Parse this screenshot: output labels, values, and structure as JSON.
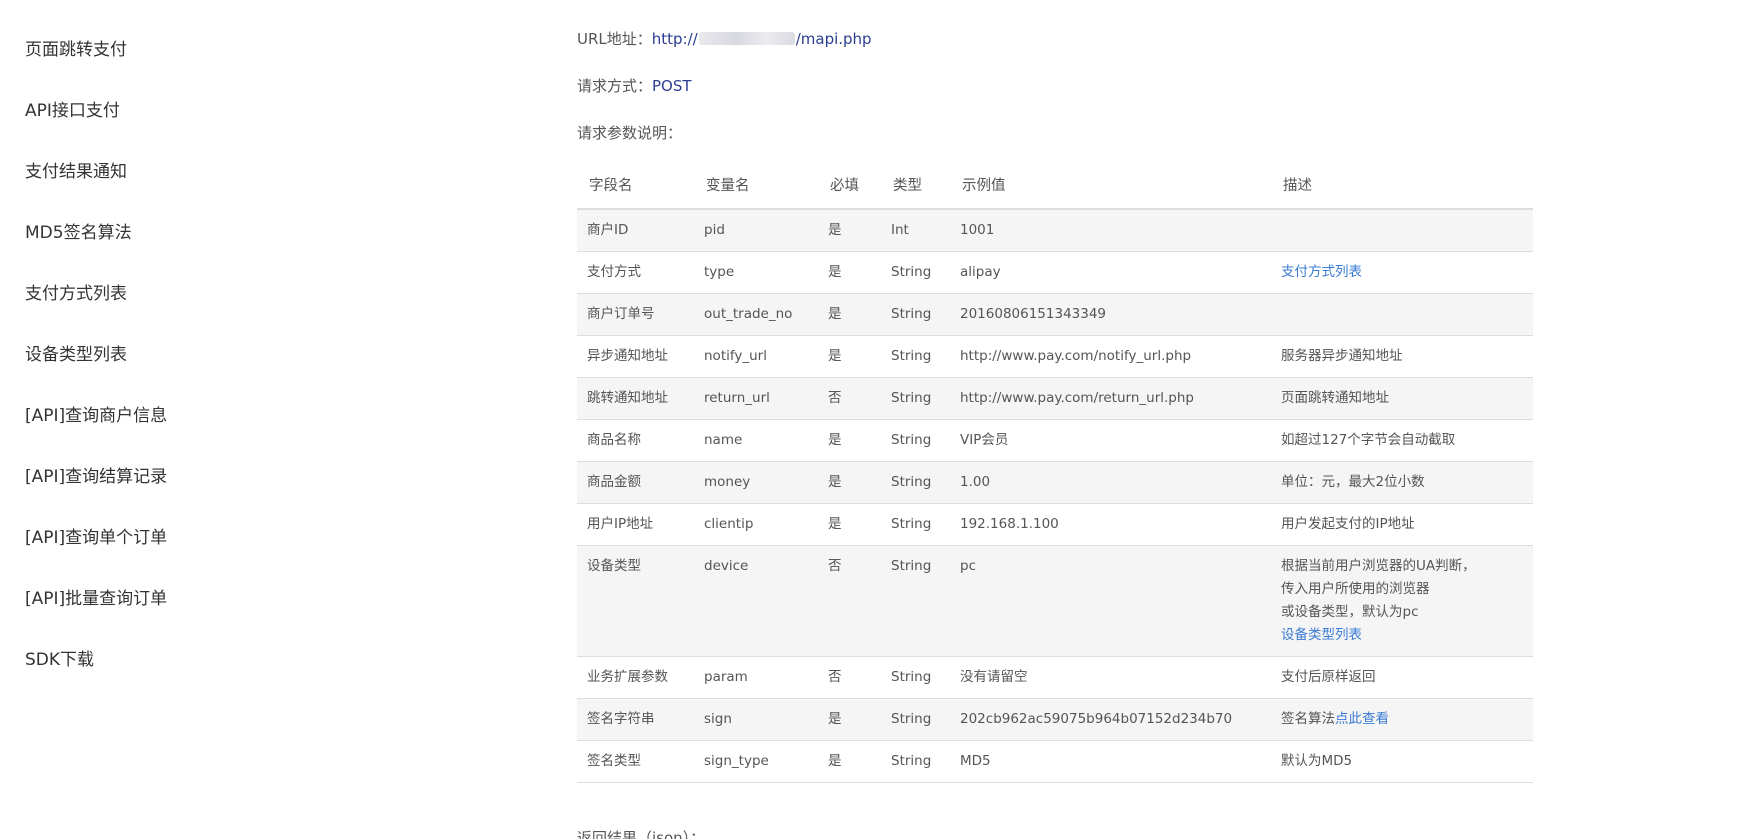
{
  "sidebar": {
    "items": [
      {
        "label": "页面跳转支付"
      },
      {
        "label": "API接口支付"
      },
      {
        "label": "支付结果通知"
      },
      {
        "label": "MD5签名算法"
      },
      {
        "label": "支付方式列表"
      },
      {
        "label": "设备类型列表"
      },
      {
        "label": "[API]查询商户信息"
      },
      {
        "label": "[API]查询结算记录"
      },
      {
        "label": "[API]查询单个订单"
      },
      {
        "label": "[API]批量查询订单"
      },
      {
        "label": "SDK下载"
      }
    ]
  },
  "main": {
    "url_label": "URL地址：",
    "url_prefix": "http://",
    "url_suffix": "/mapi.php",
    "method_label": "请求方式：",
    "method_value": "POST",
    "params_label": "请求参数说明：",
    "return_label": "返回结果（json）：",
    "table": {
      "headers": [
        "字段名",
        "变量名",
        "必填",
        "类型",
        "示例值",
        "描述"
      ],
      "rows": [
        {
          "field": "商户ID",
          "var": "pid",
          "required": "是",
          "type": "Int",
          "example": "1001",
          "desc": ""
        },
        {
          "field": "支付方式",
          "var": "type",
          "required": "是",
          "type": "String",
          "example": "alipay",
          "desc_link": "支付方式列表"
        },
        {
          "field": "商户订单号",
          "var": "out_trade_no",
          "required": "是",
          "type": "String",
          "example": "20160806151343349",
          "desc": ""
        },
        {
          "field": "异步通知地址",
          "var": "notify_url",
          "required": "是",
          "type": "String",
          "example": "http://www.pay.com/notify_url.php",
          "desc": "服务器异步通知地址"
        },
        {
          "field": "跳转通知地址",
          "var": "return_url",
          "required": "否",
          "type": "String",
          "example": "http://www.pay.com/return_url.php",
          "desc": "页面跳转通知地址"
        },
        {
          "field": "商品名称",
          "var": "name",
          "required": "是",
          "type": "String",
          "example": "VIP会员",
          "desc": "如超过127个字节会自动截取"
        },
        {
          "field": "商品金额",
          "var": "money",
          "required": "是",
          "type": "String",
          "example": "1.00",
          "desc": "单位：元，最大2位小数"
        },
        {
          "field": "用户IP地址",
          "var": "clientip",
          "required": "是",
          "type": "String",
          "example": "192.168.1.100",
          "desc": "用户发起支付的IP地址"
        },
        {
          "field": "设备类型",
          "var": "device",
          "required": "否",
          "type": "String",
          "example": "pc",
          "desc_line1": "根据当前用户浏览器的UA判断，",
          "desc_line2": "传入用户所使用的浏览器",
          "desc_line3": "或设备类型，默认为pc",
          "desc_link": "设备类型列表"
        },
        {
          "field": "业务扩展参数",
          "var": "param",
          "required": "否",
          "type": "String",
          "example": "没有请留空",
          "desc": "支付后原样返回"
        },
        {
          "field": "签名字符串",
          "var": "sign",
          "required": "是",
          "type": "String",
          "example": "202cb962ac59075b964b07152d234b70",
          "desc": "签名算法",
          "desc_link": "点此查看"
        },
        {
          "field": "签名类型",
          "var": "sign_type",
          "required": "是",
          "type": "String",
          "example": "MD5",
          "desc": "默认为MD5"
        }
      ]
    }
  }
}
